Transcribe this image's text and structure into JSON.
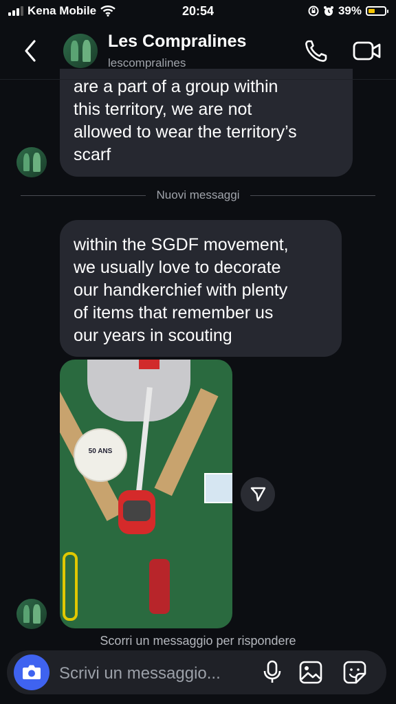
{
  "status_bar": {
    "carrier": "Kena Mobile",
    "time": "20:54",
    "battery": "39%",
    "battery_level": 0.39
  },
  "header": {
    "name": "Les Compralines",
    "username": "lescompralines"
  },
  "messages": [
    {
      "text": "are a part of a group within\nthis territory, we are not\nallowed to wear the territory’s\nscarf"
    },
    {
      "text": "within the SGDF movement,\nwe usually love to decorate\nour handkerchief with plenty\nof items that remember us\nour years in scouting"
    }
  ],
  "divider": {
    "label": "Nuovi messaggi"
  },
  "photo": {
    "badge_text": "50 ANS"
  },
  "hint": {
    "text": "Scorri un messaggio per rispondere"
  },
  "composer": {
    "placeholder": "Scrivi un messaggio..."
  },
  "icons": [
    "back-arrow-icon",
    "phone-icon",
    "video-camera-icon",
    "send-icon",
    "camera-icon",
    "microphone-icon",
    "image-icon",
    "sticker-icon"
  ]
}
